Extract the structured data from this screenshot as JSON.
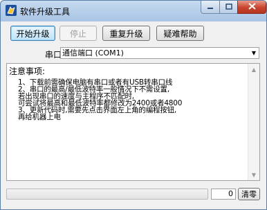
{
  "window": {
    "title": "软件升级工具",
    "controls": {
      "minimize_icon": "minimize-icon",
      "maximize_icon": "maximize-icon",
      "close_icon": "close-icon"
    }
  },
  "toolbar": {
    "start_label": "开始升级",
    "stop_label": "停止",
    "repeat_label": "重复升级",
    "help_label": "疑难帮助"
  },
  "port": {
    "label": "串口",
    "selected": "通信端口 (COM1)"
  },
  "notes": {
    "title": "注意事项:",
    "lines": [
      "1、下载前需确保电脑有串口或者有USB转串口线",
      "2、串口的最高/最低波特率一般情况下不需设置,",
      "    若出现串口的速度与主程序不匹配时,",
      "    可尝试将最高和最低波特率都修改为2400或者4800",
      "3、更新代码时,需要先点击界面左上角的编程按钮,",
      "    再给机器上电"
    ]
  },
  "status": {
    "progress": 0,
    "count": "0",
    "clear_label": "清零"
  },
  "colors": {
    "titlebar_top": "#c7daf0",
    "close_button": "#c8442e",
    "progress_fill": "#06b025"
  }
}
